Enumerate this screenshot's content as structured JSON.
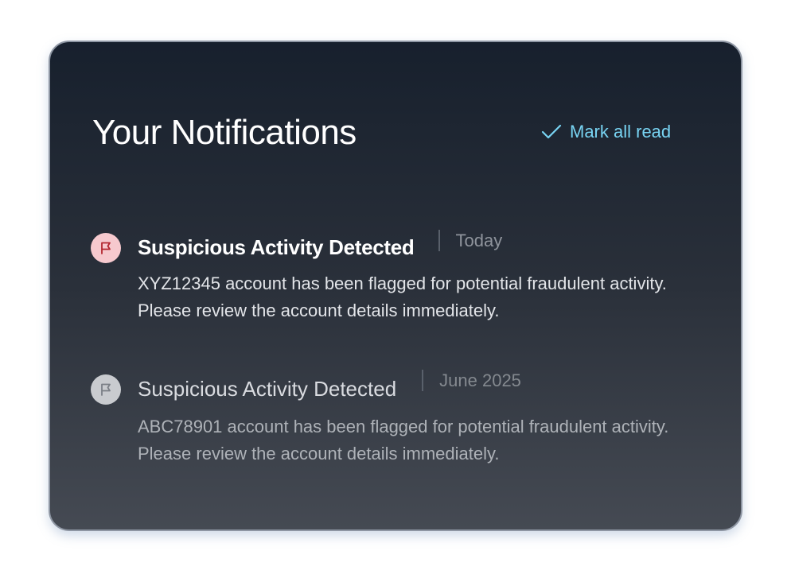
{
  "header": {
    "title": "Your Notifications",
    "mark_all_label": "Mark all read",
    "mark_all_icon": "check-icon",
    "accent_color": "#78d4f3"
  },
  "notifications": [
    {
      "icon": "flag-icon",
      "icon_color": "#b3262f",
      "icon_bg": "#f6c9ce",
      "title": "Suspicious Activity Detected",
      "date": "Today",
      "body": "XYZ12345 account has been flagged for potential fraudulent activity. Please review the account details immediately.",
      "unread": true
    },
    {
      "icon": "flag-icon",
      "icon_color": "#7b7f86",
      "icon_bg": "#c9cbcf",
      "title": "Suspicious Activity Detected",
      "date": "June 2025",
      "body": "ABC78901 account has been flagged for potential fraudulent activity. Please review the account details immediately.",
      "unread": false
    }
  ]
}
